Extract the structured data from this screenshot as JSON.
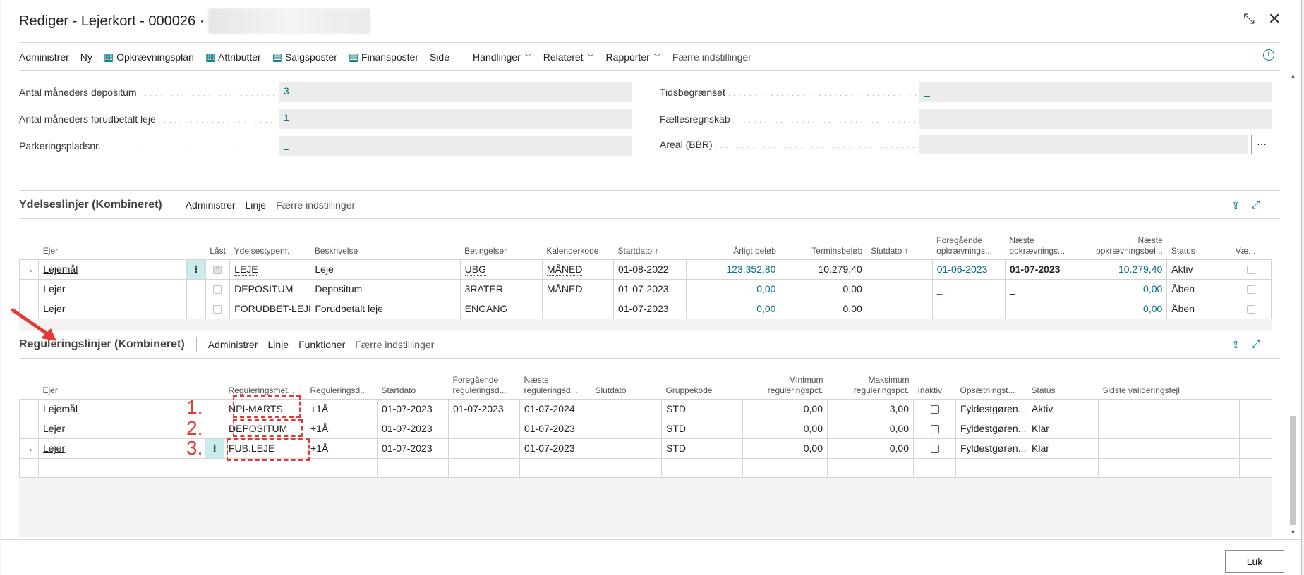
{
  "window": {
    "title": "Rediger - Lejerkort - 000026 ·",
    "collapse_icon": "collapse-icon",
    "close_icon": "close-icon"
  },
  "actions": {
    "administrer": "Administrer",
    "ny": "Ny",
    "opkraevningsplan": "Opkrævningsplan",
    "attributter": "Attributter",
    "salgsposter": "Salgsposter",
    "finansposter": "Finansposter",
    "side": "Side",
    "handlinger": "Handlinger",
    "relateret": "Relateret",
    "rapporter": "Rapporter",
    "faerre": "Færre indstillinger"
  },
  "fields": {
    "left": [
      {
        "label": "Antal måneders depositum",
        "value": "3"
      },
      {
        "label": "Antal måneders forudbetalt leje",
        "value": "1"
      },
      {
        "label": "Parkeringspladsnr.",
        "value": "_"
      }
    ],
    "right": [
      {
        "label": "Tidsbegrænset",
        "value": "_"
      },
      {
        "label": "Fællesregnskab",
        "value": "_"
      },
      {
        "label": "Areal (BBR)",
        "value": ""
      }
    ],
    "ellipsis": "···"
  },
  "ydelses": {
    "title": "Ydelseslinjer (Kombineret)",
    "actions": [
      "Administrer",
      "Linje",
      "Færre indstillinger"
    ],
    "headers": [
      "Ejer",
      "Låst",
      "Ydelsestypenr.",
      "Beskrivelse",
      "Betingelser",
      "Kalenderkode",
      "Startdato ↑",
      "Årligt beløb",
      "Terminsbeløb",
      "Slutdato ↑",
      "Foregående opkrævnings...",
      "Næste opkrævnings...",
      "Næste opkrævningsbel...",
      "Status",
      "Væ..."
    ],
    "headers_line1": {
      "foregaaende": "Foregående",
      "naeste": "Næste",
      "naeste_bel": "Næste"
    },
    "headers_line2": {
      "foregaaende": "opkrævnings...",
      "naeste": "opkrævnings...",
      "naeste_bel": "opkrævningsbel..."
    },
    "rows": [
      {
        "ejer": "Lejemål",
        "ydelse": "LEJE",
        "beskrivelse": "Leje",
        "betingelser": "UBG",
        "kalender": "MÅNED",
        "startdato": "01-08-2022",
        "aarligt": "123.352,80",
        "termin": "10.279,40",
        "slutdato": "",
        "foreg": "01-06-2023",
        "naeste": "01-07-2023",
        "naeste_bel": "10.279,40",
        "status": "Aktiv"
      },
      {
        "ejer": "Lejer",
        "ydelse": "DEPOSITUM",
        "beskrivelse": "Depositum",
        "betingelser": "3RATER",
        "kalender": "MÅNED",
        "startdato": "01-07-2023",
        "aarligt": "0,00",
        "termin": "0,00",
        "slutdato": "",
        "foreg": "_",
        "naeste": "_",
        "naeste_bel": "0,00",
        "status": "Åben"
      },
      {
        "ejer": "Lejer",
        "ydelse": "FORUDBET-LEJE",
        "beskrivelse": "Forudbetalt leje",
        "betingelser": "ENGANG",
        "kalender": "",
        "startdato": "01-07-2023",
        "aarligt": "0,00",
        "termin": "0,00",
        "slutdato": "",
        "foreg": "_",
        "naeste": "_",
        "naeste_bel": "0,00",
        "status": "Åben"
      }
    ]
  },
  "regulering": {
    "title": "Reguleringslinjer (Kombineret)",
    "actions": [
      "Administrer",
      "Linje",
      "Funktioner",
      "Færre indstillinger"
    ],
    "headers": {
      "ejer": "Ejer",
      "metode": "Reguleringsmet...",
      "regd": "Reguleringsd...",
      "startdato": "Startdato",
      "foreg1": "Foregående",
      "foreg2": "reguleringsd...",
      "naeste1": "Næste",
      "naeste2": "reguleringsd...",
      "slutdato": "Slutdato",
      "gruppe": "Gruppekode",
      "min1": "Minimum",
      "min2": "reguleringspct.",
      "max1": "Maksimum",
      "max2": "reguleringspct.",
      "inaktiv": "Inaktiv",
      "opsaet": "Opsætningst...",
      "status": "Status",
      "sidste": "Sidste valideringsfejl"
    },
    "rows": [
      {
        "ejer": "Lejemål",
        "metode": "NPI-MARTS",
        "regd": "+1Å",
        "startdato": "01-07-2023",
        "foreg": "01-07-2023",
        "naeste": "01-07-2024",
        "gruppe": "STD",
        "min": "0,00",
        "max": "3,00",
        "opsaet": "Fyldestgøren...",
        "status": "Aktiv"
      },
      {
        "ejer": "Lejer",
        "metode": "DEPOSITUM",
        "regd": "+1Å",
        "startdato": "01-07-2023",
        "foreg": "",
        "naeste": "01-07-2023",
        "gruppe": "STD",
        "min": "0,00",
        "max": "0,00",
        "opsaet": "Fyldestgøren...",
        "status": "Klar"
      },
      {
        "ejer": "Lejer",
        "metode": "FUB.LEJE",
        "regd": "+1Å",
        "startdato": "01-07-2023",
        "foreg": "",
        "naeste": "01-07-2023",
        "gruppe": "STD",
        "min": "0,00",
        "max": "0,00",
        "opsaet": "Fyldestgøren...",
        "status": "Klar"
      }
    ],
    "annotations": [
      "1.",
      "2.",
      "3."
    ]
  },
  "footer": {
    "luk": "Luk"
  },
  "colors": {
    "teal": "#00707a",
    "annotation_red": "#e53935",
    "row_marker": "#c8ecec"
  }
}
